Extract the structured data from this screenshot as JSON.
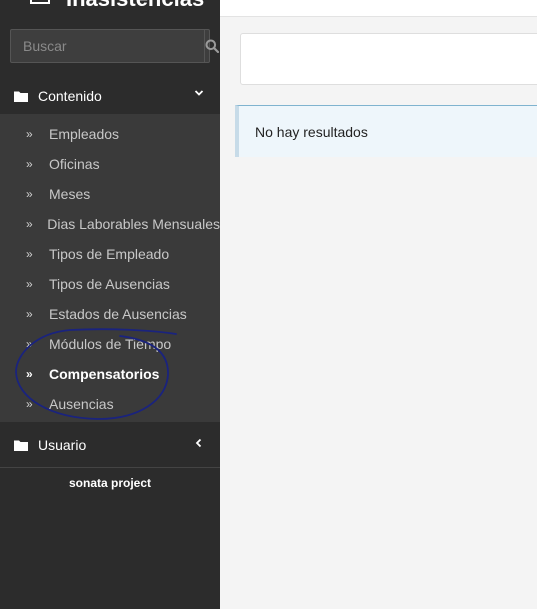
{
  "brand": {
    "name": "Inasistencias"
  },
  "search": {
    "placeholder": "Buscar",
    "icon": "search-icon"
  },
  "menu": {
    "contenido": {
      "label": "Contenido",
      "icon": "folder-icon",
      "toggle_icon": "chevron-down-icon",
      "items": [
        {
          "label": "Empleados"
        },
        {
          "label": "Oficinas"
        },
        {
          "label": "Meses"
        },
        {
          "label": "Dias Laborables Mensuales"
        },
        {
          "label": "Tipos de Empleado"
        },
        {
          "label": "Tipos de Ausencias"
        },
        {
          "label": "Estados de Ausencias"
        },
        {
          "label": "Módulos de Tiempo"
        },
        {
          "label": "Compensatorios"
        },
        {
          "label": "Ausencias"
        }
      ],
      "active_item": "Compensatorios"
    },
    "usuario": {
      "label": "Usuario",
      "icon": "folder-icon",
      "toggle_icon": "chevron-left-icon"
    }
  },
  "footer": {
    "label": "sonata project"
  },
  "main": {
    "empty_message": "No hay resultados"
  },
  "colors": {
    "sidebar_bg": "#2c2c2c",
    "submenu_bg": "#3a3a3a",
    "alert_bg": "#eef6fb",
    "annotation": "#1a237e"
  }
}
